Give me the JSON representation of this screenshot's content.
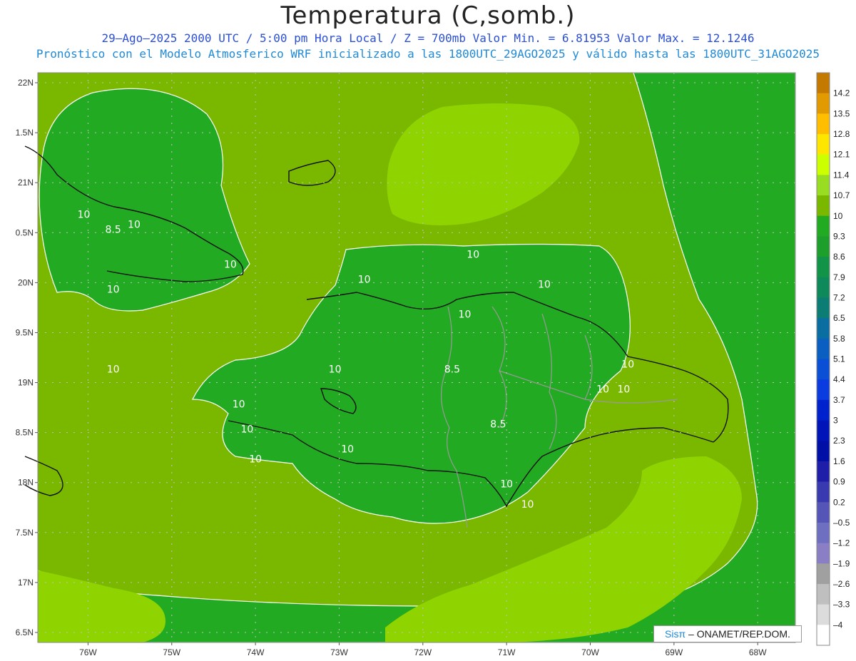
{
  "header": {
    "title": "Temperatura (C,somb.)",
    "line1": "29–Ago–2025  2000 UTC / 5:00 pm Hora Local / Z = 700mb    Valor Min. = 6.81953  Valor Max. = 12.1246",
    "line2": "Pronóstico con el Modelo Atmosferico WRF inicializado a las 1800UTC_29AGO2025 y válido hasta las  1800UTC_31AGO2025"
  },
  "axes": {
    "lat_labels": [
      "22N",
      "1.5N",
      "21N",
      "0.5N",
      "20N",
      "9.5N",
      "19N",
      "8.5N",
      "18N",
      "7.5N",
      "17N",
      "6.5N"
    ],
    "lon_labels": [
      "76W",
      "75W",
      "74W",
      "73W",
      "72W",
      "71W",
      "70W",
      "69W",
      "68W"
    ]
  },
  "legend": {
    "labels": [
      "14.2",
      "13.5",
      "12.8",
      "12.1",
      "11.4",
      "10.7",
      "10",
      "9.3",
      "8.6",
      "7.9",
      "7.2",
      "6.5",
      "5.8",
      "5.1",
      "4.4",
      "3.7",
      "3",
      "2.3",
      "1.6",
      "0.9",
      "0.2",
      "–0.5",
      "–1.2",
      "–1.9",
      "–2.6",
      "–3.3",
      "–4"
    ],
    "colors": [
      "#c47a00",
      "#e19a00",
      "#ffbf00",
      "#ffe600",
      "#ccff00",
      "#99dd22",
      "#7ab800",
      "#22aa22",
      "#1e9e2a",
      "#119448",
      "#0e8a5a",
      "#0c7d75",
      "#0a6fa0",
      "#0a5fc0",
      "#0a4fd6",
      "#0a3ce0",
      "#0022cc",
      "#0014b8",
      "#000fa6",
      "#1e1ea8",
      "#3a3ab0",
      "#5555b8",
      "#6f6fc2",
      "#8a7fc4",
      "#a0a0a0",
      "#bfbfbf",
      "#dcdcdc",
      "#ffffff"
    ]
  },
  "contour_labels": [
    {
      "text": "10",
      "lon": -76.05,
      "lat": 20.65
    },
    {
      "text": "10",
      "lon": -75.45,
      "lat": 20.55
    },
    {
      "text": "8.5",
      "lon": -75.7,
      "lat": 20.5
    },
    {
      "text": "10",
      "lon": -74.3,
      "lat": 20.15
    },
    {
      "text": "10",
      "lon": -75.7,
      "lat": 19.9
    },
    {
      "text": "10",
      "lon": -75.7,
      "lat": 19.1
    },
    {
      "text": "10",
      "lon": -71.4,
      "lat": 20.25
    },
    {
      "text": "10",
      "lon": -72.7,
      "lat": 20.0
    },
    {
      "text": "10",
      "lon": -70.55,
      "lat": 19.95
    },
    {
      "text": "10",
      "lon": -71.5,
      "lat": 19.65
    },
    {
      "text": "10",
      "lon": -73.05,
      "lat": 19.1
    },
    {
      "text": "8.5",
      "lon": -71.65,
      "lat": 19.1
    },
    {
      "text": "10",
      "lon": -69.55,
      "lat": 19.15
    },
    {
      "text": "10",
      "lon": -69.6,
      "lat": 18.9
    },
    {
      "text": "10",
      "lon": -69.85,
      "lat": 18.9
    },
    {
      "text": "10",
      "lon": -74.2,
      "lat": 18.75
    },
    {
      "text": "10",
      "lon": -74.1,
      "lat": 18.5
    },
    {
      "text": "10",
      "lon": -72.9,
      "lat": 18.3
    },
    {
      "text": "10",
      "lon": -74.0,
      "lat": 18.2
    },
    {
      "text": "8.5",
      "lon": -71.1,
      "lat": 18.55
    },
    {
      "text": "10",
      "lon": -71.0,
      "lat": 17.95
    },
    {
      "text": "10",
      "lon": -70.75,
      "lat": 17.75
    }
  ],
  "credit": {
    "brand": "Sisπ",
    "text": " – ONAMET/REP.DOM."
  }
}
